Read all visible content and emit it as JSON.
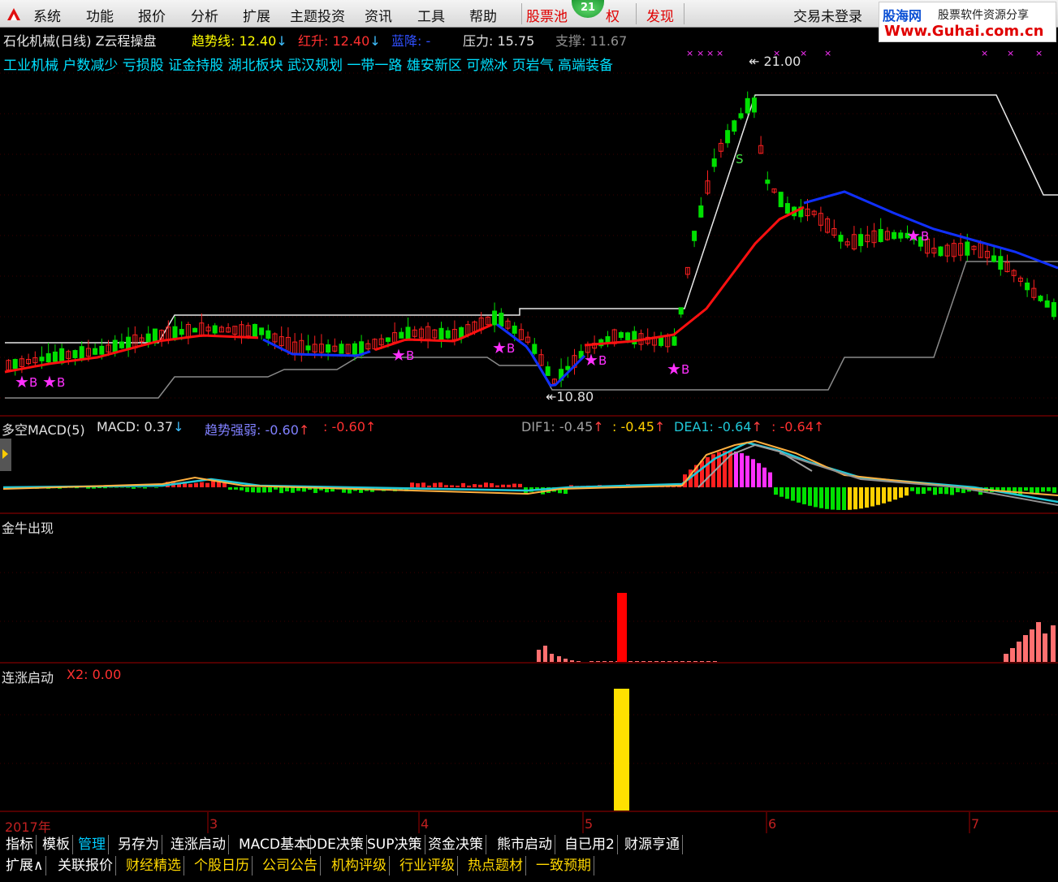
{
  "menu": {
    "items": [
      "系统",
      "功能",
      "报价",
      "分析",
      "扩展",
      "主题投资",
      "资讯",
      "工具",
      "帮助"
    ],
    "stock_pool": "股票池",
    "badge_count": "21",
    "hidden_tab_suffix": "权",
    "discover": "发现",
    "login_status": "交易未登录"
  },
  "watermark": {
    "brand": "股海网",
    "slogan": "股票软件资源分享",
    "url": "Www.Guhai.com.cn"
  },
  "main_chart": {
    "stock_title": "石化机械(日线) Z云程操盘",
    "indicators": [
      {
        "label": "趋势线: 12.40",
        "arrow": "↓",
        "color": "#ffff00"
      },
      {
        "label": "红升: 12.40",
        "arrow": "↓",
        "color": "#ff3030"
      },
      {
        "label": "蓝降: -",
        "arrow": "",
        "color": "#3050ff"
      },
      {
        "label": "压力: 15.75",
        "arrow": "",
        "color": "#e0e0e0"
      },
      {
        "label": "支撑: 11.67",
        "arrow": "",
        "color": "#909090"
      }
    ],
    "concepts": "工业机械 户数减少 亏损股 证金持股 湖北板块 武汉规划 一带一路 雄安新区 可燃冰 页岩气 高端装备",
    "high_marker": "21.00",
    "low_marker": "10.80",
    "sell_marker": "S",
    "buy_marker": "B"
  },
  "macd_panel": {
    "title": "多空MACD(5)",
    "macd": "MACD: 0.37",
    "macd_arrow": "↓",
    "trend": "趋势强弱: -0.60",
    "trend_arrow": "↑",
    "trend2": ": -0.60",
    "dif": "DIF1: -0.45",
    "dif2": ": -0.45",
    "dea": "DEA1: -0.64",
    "dea2": ": -0.64"
  },
  "bull_panel": {
    "title": "金牛出现"
  },
  "rise_panel": {
    "title": "连涨启动",
    "value": "X2: 0.00"
  },
  "time_axis": {
    "year": "2017年",
    "months": [
      "3",
      "4",
      "5",
      "6",
      "7"
    ]
  },
  "tabs_row1": [
    "指标",
    "模板",
    "管理",
    "另存为",
    "连涨启动",
    "MACD基本",
    "DDE决策",
    "SUP决策",
    "资金决策",
    "熊市启动",
    "自已用2",
    "财源亨通"
  ],
  "tabs_row2": [
    "扩展∧",
    "关联报价",
    "财经精选",
    "个股日历",
    "公司公告",
    "机构评级",
    "行业评级",
    "热点题材",
    "一致预期"
  ],
  "colors": {
    "up": "#ff2020",
    "down": "#00e000",
    "trend_red": "#ff1010",
    "trend_blue": "#1030ff",
    "pressure": "#e8e8e8",
    "support": "#8a8a8a",
    "panel_border": "#a00000",
    "tab_active": "#00ccff",
    "tab_yellow": "#ffd700"
  }
}
